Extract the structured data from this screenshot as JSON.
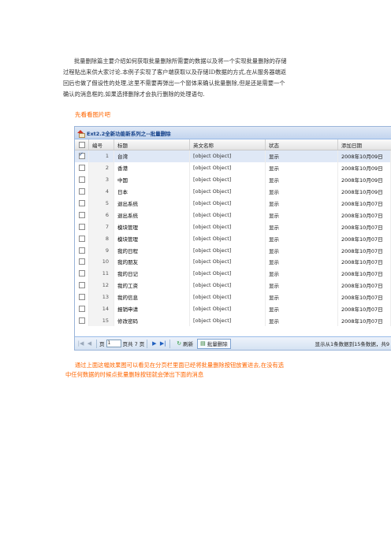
{
  "intro": {
    "lines": [
      "批量删除篇主要介绍如何获取批量删除所需要的数据以及将一个实现批量删除的存储",
      "过程贴出来供大家讨论.本例子实现了客户端获取以及存储ID数据的方式,在从服务器端返",
      "回后也做了假设性的处理,这里不需要再弹出一个窗体来确认批量删除,但是还是需要一个",
      "确认的消息框的,如果选择删除才会执行删除的处理语句."
    ]
  },
  "lead": "先看看图片吧",
  "window": {
    "title": "Ext2.2全新功能新系列之--批量删除"
  },
  "grid": {
    "headers": [
      "编号",
      "标题",
      "英文名称",
      "状态",
      "添加日期"
    ],
    "rows": [
      {
        "no": "1",
        "title": "台湾",
        "en": "[object Object]",
        "status": "显示",
        "date": "2008年10月09日",
        "checked": true
      },
      {
        "no": "2",
        "title": "香港",
        "en": "[object Object]",
        "status": "显示",
        "date": "2008年10月09日",
        "checked": false
      },
      {
        "no": "3",
        "title": "中国",
        "en": "[object Object]",
        "status": "显示",
        "date": "2008年10月09日",
        "checked": false
      },
      {
        "no": "4",
        "title": "日本",
        "en": "[object Object]",
        "status": "显示",
        "date": "2008年10月09日",
        "checked": false
      },
      {
        "no": "5",
        "title": "退出系统",
        "en": "[object Object]",
        "status": "显示",
        "date": "2008年10月07日",
        "checked": false
      },
      {
        "no": "6",
        "title": "退出系统",
        "en": "[object Object]",
        "status": "显示",
        "date": "2008年10月07日",
        "checked": false
      },
      {
        "no": "7",
        "title": "模块管理",
        "en": "[object Object]",
        "status": "显示",
        "date": "2008年10月07日",
        "checked": false
      },
      {
        "no": "8",
        "title": "模块管理",
        "en": "[object Object]",
        "status": "显示",
        "date": "2008年10月07日",
        "checked": false
      },
      {
        "no": "9",
        "title": "我的日程",
        "en": "[object Object]",
        "status": "显示",
        "date": "2008年10月07日",
        "checked": false
      },
      {
        "no": "10",
        "title": "我的朋友",
        "en": "[object Object]",
        "status": "显示",
        "date": "2008年10月07日",
        "checked": false
      },
      {
        "no": "11",
        "title": "我的日记",
        "en": "[object Object]",
        "status": "显示",
        "date": "2008年10月07日",
        "checked": false
      },
      {
        "no": "12",
        "title": "我的工资",
        "en": "[object Object]",
        "status": "显示",
        "date": "2008年10月07日",
        "checked": false
      },
      {
        "no": "13",
        "title": "我的信息",
        "en": "[object Object]",
        "status": "显示",
        "date": "2008年10月07日",
        "checked": false
      },
      {
        "no": "14",
        "title": "报销申请",
        "en": "[object Object]",
        "status": "显示",
        "date": "2008年10月07日",
        "checked": false
      },
      {
        "no": "15",
        "title": "修改密码",
        "en": "[object Object]",
        "status": "显示",
        "date": "2008年10月07日",
        "checked": false
      }
    ]
  },
  "pager": {
    "page_label": "页",
    "page_value": "1",
    "of_label": "页共 7 页",
    "refresh_label": "刷新",
    "delete_label": "批量删除",
    "status": "显示从1条数据到15条数据，共9"
  },
  "caption": {
    "lines": [
      "通过上面这幅效果图可以看见在分页栏里面已经将批量删除按钮放置进去,在没有选",
      "中任何数据的时候点批量删除按钮就会弹出下面的消息"
    ]
  },
  "colors": {
    "accent": "#ff6600",
    "grid_border": "#99bbe8",
    "title_text": "#15428b"
  }
}
